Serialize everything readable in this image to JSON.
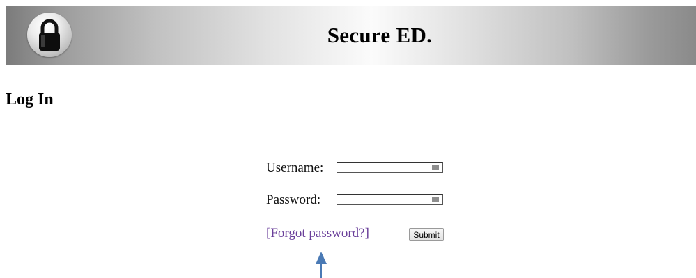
{
  "banner": {
    "title": "Secure ED.",
    "logo_icon": "padlock-icon"
  },
  "page": {
    "heading": "Log In"
  },
  "login_form": {
    "username_label": "Username:",
    "username_value": "",
    "password_label": "Password:",
    "password_value": "",
    "field_icon": "password-manager-key-icon",
    "forgot_link": "[Forgot password?]",
    "submit_label": "Submit"
  },
  "annotation": {
    "arrow_icon": "up-arrow-icon",
    "arrow_color": "#4a7ab5"
  },
  "colors": {
    "link": "#6a3f9a",
    "divider": "#b4b4b4"
  }
}
